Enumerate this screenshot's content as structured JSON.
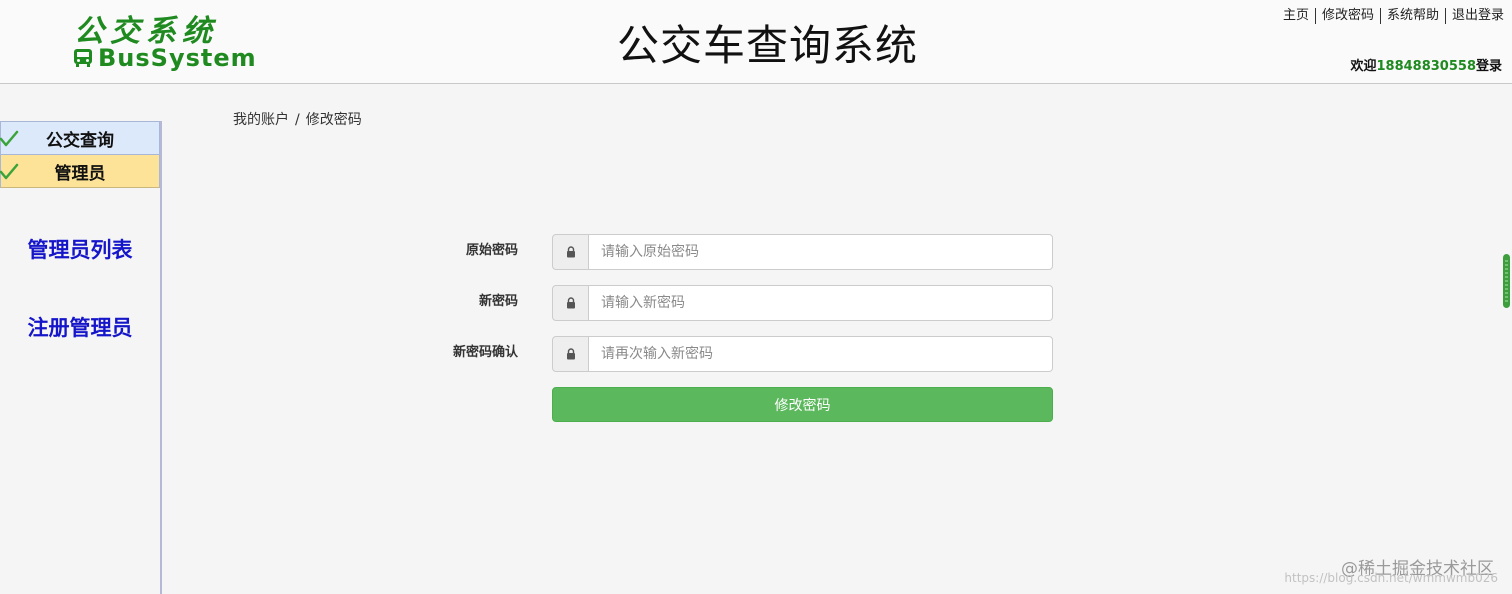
{
  "header": {
    "logo_cn": "公交系统",
    "logo_en": "BusSystem",
    "title": "公交车查询系统",
    "links": [
      "主页",
      "修改密码",
      "系统帮助",
      "退出登录"
    ],
    "welcome_prefix": "欢迎",
    "welcome_user": "18848830558",
    "welcome_suffix": "登录"
  },
  "sidebar": {
    "menu": [
      {
        "label": "公交查询"
      },
      {
        "label": "管理员"
      }
    ],
    "sub_links": [
      "管理员列表",
      "注册管理员"
    ]
  },
  "breadcrumb": {
    "items": [
      "我的账户",
      "修改密码"
    ],
    "separator": "/"
  },
  "form": {
    "fields": [
      {
        "label": "原始密码",
        "placeholder": "请输入原始密码",
        "value": ""
      },
      {
        "label": "新密码",
        "placeholder": "请输入新密码",
        "value": ""
      },
      {
        "label": "新密码确认",
        "placeholder": "请再次输入新密码",
        "value": ""
      }
    ],
    "submit_label": "修改密码"
  },
  "watermark": {
    "text": "@稀土掘金技术社区",
    "url": "https://blog.csdn.net/wmmwmb026"
  },
  "colors": {
    "brand_green": "#1f8a1f",
    "button_green": "#5cb85c",
    "link_blue": "#1515c9",
    "menu_blue": "#dce9fb",
    "menu_yellow": "#fde397"
  }
}
